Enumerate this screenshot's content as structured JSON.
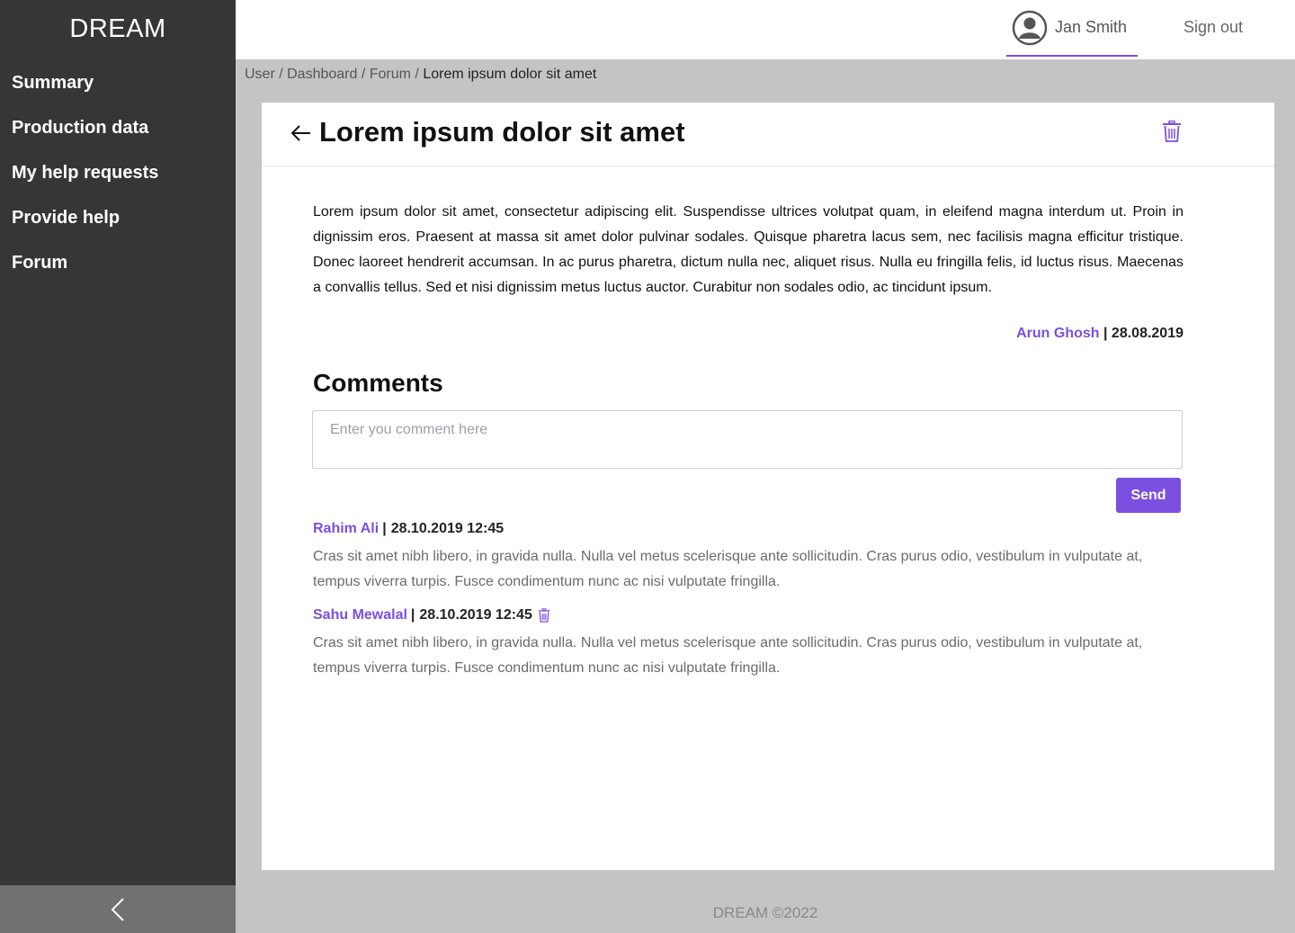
{
  "sidebar": {
    "brand": "DREAM",
    "items": [
      {
        "label": "Summary"
      },
      {
        "label": "Production data"
      },
      {
        "label": "My help requests"
      },
      {
        "label": "Provide help"
      },
      {
        "label": "Forum"
      }
    ],
    "collapse_icon": "chevron-left-icon"
  },
  "header": {
    "user_icon": "user-circle-icon",
    "user_name": "Jan Smith",
    "sign_out": "Sign out"
  },
  "breadcrumb": {
    "items": [
      "User",
      "Dashboard",
      "Forum"
    ],
    "separator": " / ",
    "current": "Lorem ipsum dolor sit amet"
  },
  "post": {
    "title": "Lorem ipsum dolor sit amet",
    "body": "Lorem ipsum dolor sit amet, consectetur adipiscing elit. Suspendisse ultrices volutpat quam, in eleifend magna interdum ut. Proin in dignissim eros. Praesent at massa sit amet dolor pulvinar sodales. Quisque pharetra lacus sem, nec facilisis magna efficitur tristique. Donec laoreet hendrerit accumsan. In ac purus pharetra, dictum nulla nec, aliquet risus. Nulla eu fringilla felis, id luctus risus. Maecenas a convallis tellus. Sed et nisi dignissim metus luctus auctor. Curabitur non sodales odio, ac tincidunt ipsum.",
    "author": "Arun Ghosh",
    "date": "28.08.2019"
  },
  "comments": {
    "title": "Comments",
    "placeholder": "Enter you comment here",
    "send_label": "Send",
    "separator": "|",
    "items": [
      {
        "author": "Rahim Ali",
        "datetime": "28.10.2019 12:45",
        "text": "Cras sit amet nibh libero, in gravida nulla. Nulla vel metus scelerisque ante sollicitudin. Cras purus odio, vestibulum in vulputate at, tempus viverra turpis. Fusce condimentum nunc ac nisi vulputate fringilla."
      },
      {
        "author": "Sahu Mewalal",
        "datetime": "28.10.2019 12:45",
        "text": "Cras sit amet nibh libero, in gravida nulla. Nulla vel metus scelerisque ante sollicitudin. Cras purus odio, vestibulum in vulputate at, tempus viverra turpis. Fusce condimentum nunc ac nisi vulputate fringilla."
      }
    ]
  },
  "footer": {
    "text": "DREAM ©2022"
  },
  "colors": {
    "accent": "#7b4fe0",
    "sidebar": "#363636",
    "background": "#c4c4c4"
  }
}
